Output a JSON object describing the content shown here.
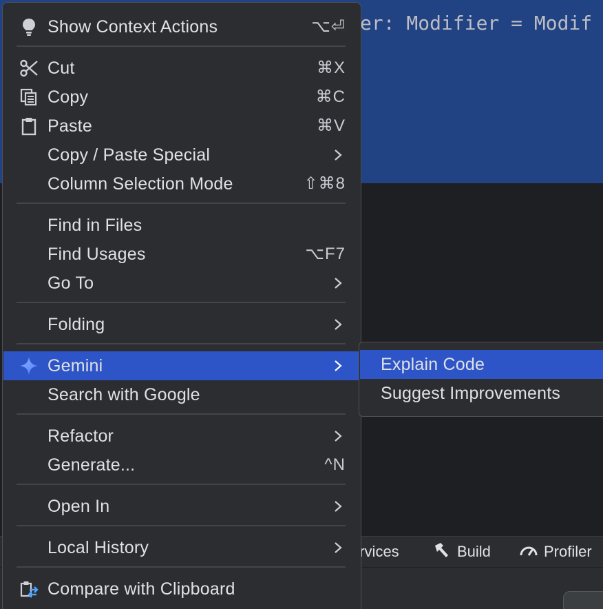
{
  "editor": {
    "code_fragment": "er: Modifier = Modif"
  },
  "toolwindows": {
    "services_label": "ervices",
    "build_label": "Build",
    "profiler_label": "Profiler",
    "build_icon": "hammer-icon",
    "profiler_icon": "gauge-icon"
  },
  "context_menu": {
    "items": [
      {
        "label": "Show Context Actions",
        "shortcut": "⌥⏎",
        "icon": "lightbulb-icon"
      },
      {
        "label": "Cut",
        "shortcut": "⌘X",
        "icon": "scissors-icon"
      },
      {
        "label": "Copy",
        "shortcut": "⌘C",
        "icon": "copy-icon"
      },
      {
        "label": "Paste",
        "shortcut": "⌘V",
        "icon": "clipboard-icon"
      },
      {
        "label": "Copy / Paste Special",
        "submenu": true
      },
      {
        "label": "Column Selection Mode",
        "shortcut": "⇧⌘8"
      },
      {
        "label": "Find in Files"
      },
      {
        "label": "Find Usages",
        "shortcut": "⌥F7"
      },
      {
        "label": "Go To",
        "submenu": true
      },
      {
        "label": "Folding",
        "submenu": true
      },
      {
        "label": "Gemini",
        "submenu": true,
        "icon": "gemini-sparkle-icon",
        "highlighted": true
      },
      {
        "label": "Search with Google"
      },
      {
        "label": "Refactor",
        "submenu": true
      },
      {
        "label": "Generate...",
        "shortcut": "^N"
      },
      {
        "label": "Open In",
        "submenu": true
      },
      {
        "label": "Local History",
        "submenu": true
      },
      {
        "label": "Compare with Clipboard",
        "icon": "compare-clipboard-icon"
      }
    ]
  },
  "gemini_submenu": {
    "items": [
      {
        "label": "Explain Code",
        "highlighted": true
      },
      {
        "label": "Suggest Improvements"
      }
    ]
  },
  "colors": {
    "menu_background": "#2b2d30",
    "highlight": "#2e55c7",
    "editor_selection": "#214283",
    "gemini_accent": "#5b8cff"
  }
}
